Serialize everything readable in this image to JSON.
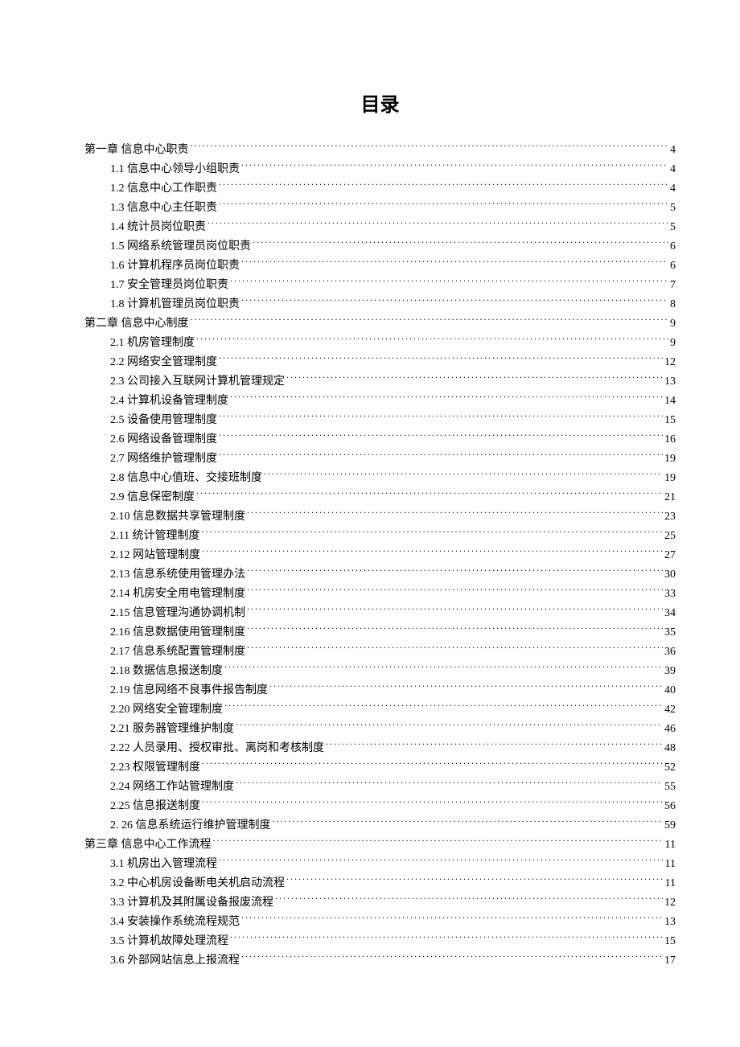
{
  "title": "目录",
  "entries": [
    {
      "level": 0,
      "text": "第一章 信息中心职责",
      "page": "4"
    },
    {
      "level": 1,
      "text": "1.1 信息中心领导小组职责",
      "page": "4"
    },
    {
      "level": 1,
      "text": "1.2 信息中心工作职责",
      "page": "4"
    },
    {
      "level": 1,
      "text": "1.3 信息中心主任职责",
      "page": "5"
    },
    {
      "level": 1,
      "text": "1.4 统计员岗位职责",
      "page": "5"
    },
    {
      "level": 1,
      "text": "1.5 网络系统管理员岗位职责",
      "page": "6"
    },
    {
      "level": 1,
      "text": "1.6 计算机程序员岗位职责",
      "page": "6"
    },
    {
      "level": 1,
      "text": "1.7 安全管理员岗位职责",
      "page": "7"
    },
    {
      "level": 1,
      "text": "1.8 计算机管理员岗位职责",
      "page": "8"
    },
    {
      "level": 0,
      "text": "第二章 信息中心制度",
      "page": "9"
    },
    {
      "level": 1,
      "text": "2.1 机房管理制度",
      "page": "9"
    },
    {
      "level": 1,
      "text": "2.2 网络安全管理制度",
      "page": "12"
    },
    {
      "level": 1,
      "text": "2.3  公司接入互联网计算机管理规定",
      "page": "13"
    },
    {
      "level": 1,
      "text": "2.4 计算机设备管理制度",
      "page": "14"
    },
    {
      "level": 1,
      "text": "2.5 设备使用管理制度",
      "page": "15"
    },
    {
      "level": 1,
      "text": "2.6 网络设备管理制度",
      "page": "16"
    },
    {
      "level": 1,
      "text": "2.7 网络维护管理制度",
      "page": "19"
    },
    {
      "level": 1,
      "text": "2.8 信息中心值班、交接班制度",
      "page": "19"
    },
    {
      "level": 1,
      "text": "2.9 信息保密制度",
      "page": "21"
    },
    {
      "level": 1,
      "text": "2.10 信息数据共享管理制度",
      "page": "23"
    },
    {
      "level": 1,
      "text": "2.11 统计管理制度",
      "page": "25"
    },
    {
      "level": 1,
      "text": "2.12 网站管理制度",
      "page": "27"
    },
    {
      "level": 1,
      "text": "2.13  信息系统使用管理办法",
      "page": "30"
    },
    {
      "level": 1,
      "text": "2.14 机房安全用电管理制度",
      "page": "33"
    },
    {
      "level": 1,
      "text": "2.15 信息管理沟通协调机制",
      "page": "34"
    },
    {
      "level": 1,
      "text": "2.16 信息数据使用管理制度",
      "page": "35"
    },
    {
      "level": 1,
      "text": "2.17 信息系统配置管理制度",
      "page": "36"
    },
    {
      "level": 1,
      "text": "2.18 数据信息报送制度",
      "page": "39"
    },
    {
      "level": 1,
      "text": "2.19 信息网络不良事件报告制度",
      "page": "40"
    },
    {
      "level": 1,
      "text": "2.20 网络安全管理制度",
      "page": "42"
    },
    {
      "level": 1,
      "text": "2.21 服务器管理维护制度",
      "page": "46"
    },
    {
      "level": 1,
      "text": "2.22 人员录用、授权审批、离岗和考核制度",
      "page": "48"
    },
    {
      "level": 1,
      "text": "2.23 权限管理制度",
      "page": "52"
    },
    {
      "level": 1,
      "text": "2.24 网络工作站管理制度",
      "page": "55"
    },
    {
      "level": 1,
      "text": "2.25 信息报送制度",
      "page": "56"
    },
    {
      "level": 1,
      "text": "2. 26 信息系统运行维护管理制度",
      "page": "59"
    },
    {
      "level": 0,
      "text": "第三章   信息中心工作流程",
      "page": "11"
    },
    {
      "level": 1,
      "text": "3.1 机房出入管理流程",
      "page": "11"
    },
    {
      "level": 1,
      "text": "3.2 中心机房设备断电关机启动流程",
      "page": "11"
    },
    {
      "level": 1,
      "text": "3.3 计算机及其附属设备报废流程",
      "page": "12"
    },
    {
      "level": 1,
      "text": "3.4 安装操作系统流程规范",
      "page": "13"
    },
    {
      "level": 1,
      "text": "3.5 计算机故障处理流程",
      "page": "15"
    },
    {
      "level": 1,
      "text": "3.6 外部网站信息上报流程",
      "page": "17"
    }
  ]
}
